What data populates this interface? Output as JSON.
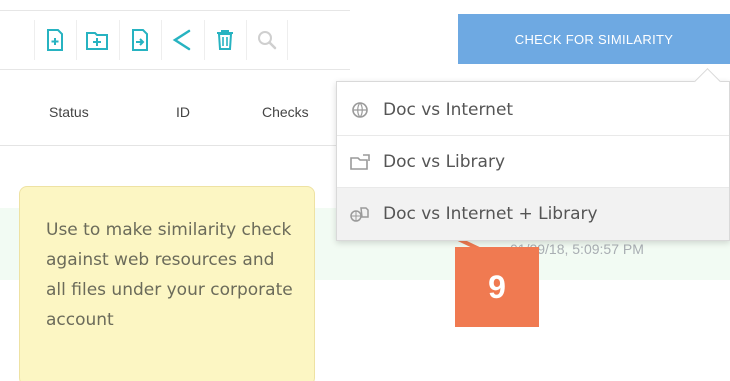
{
  "toolbar": {
    "buttons": [
      {
        "name": "new-document-icon"
      },
      {
        "name": "new-folder-icon"
      },
      {
        "name": "move-document-icon"
      },
      {
        "name": "share-icon"
      },
      {
        "name": "trash-icon"
      },
      {
        "name": "search-icon"
      }
    ],
    "check_button_label": "CHECK FOR SIMILARITY"
  },
  "table": {
    "headers": {
      "status": "Status",
      "id": "ID",
      "checks": "Checks"
    },
    "row": {
      "date": "01/29/18, 5:09:57 PM"
    }
  },
  "dropdown": {
    "items": [
      {
        "label": "Doc vs Internet",
        "icon": "globe-icon"
      },
      {
        "label": "Doc vs Library",
        "icon": "library-folder-icon"
      },
      {
        "label": "Doc vs Internet + Library",
        "icon": "internet-library-icon"
      }
    ],
    "highlighted_index": 2
  },
  "tooltip": {
    "text": "Use to make similarity check against web resources and all files under your corporate account"
  },
  "badge": {
    "label": "9"
  },
  "colors": {
    "accent_blue": "#6ea9e2",
    "tooltip_bg": "#fcf6c3",
    "badge_orange": "#f07a51",
    "row_green": "#f2fbf3",
    "icon_teal": "#27b3c1"
  }
}
